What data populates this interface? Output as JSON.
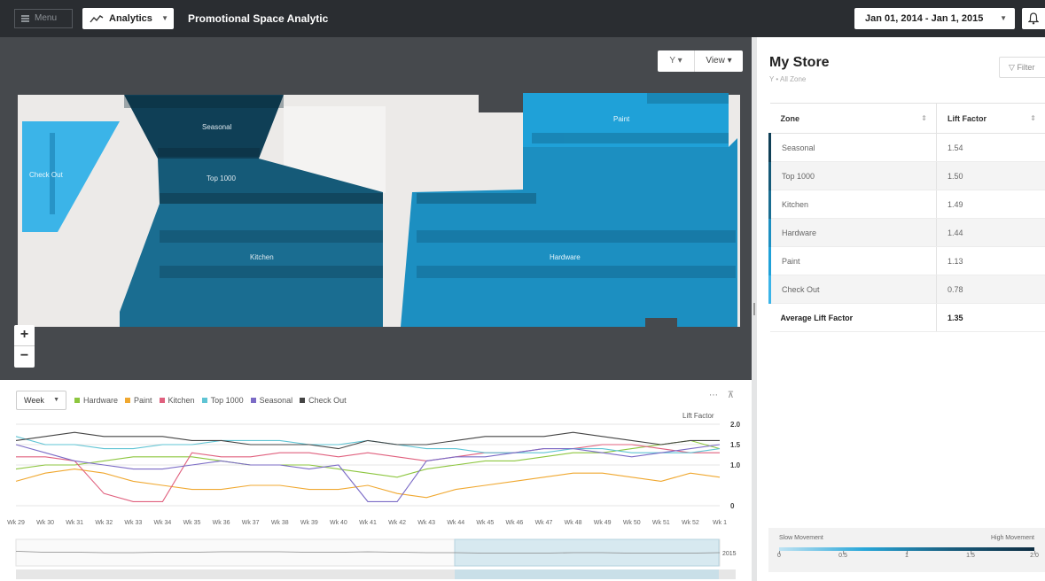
{
  "topbar": {
    "menu_label": "Menu",
    "analytics_label": "Analytics",
    "app_title": "Promotional Space Analytic",
    "date_range": "Jan 01, 2014 - Jan 1, 2015"
  },
  "map": {
    "filter_label": "Y",
    "view_label": "View",
    "zones": [
      {
        "name": "Seasonal",
        "color": "#0f3f56"
      },
      {
        "name": "Top 1000",
        "color": "#155a78"
      },
      {
        "name": "Kitchen",
        "color": "#1a6d91"
      },
      {
        "name": "Check Out",
        "color": "#3bb4e8"
      },
      {
        "name": "Paint",
        "color": "#1fa1d8"
      },
      {
        "name": "Hardware",
        "color": "#1c8fc1"
      }
    ],
    "zoom_in": "+",
    "zoom_out": "−"
  },
  "panel": {
    "title": "My Store",
    "subtitle": "Y • All Zone",
    "filter_label": "Filter",
    "columns": [
      "Zone",
      "Lift Factor"
    ],
    "rows": [
      {
        "zone": "Seasonal",
        "lift": "1.54",
        "color": "#0f3f56"
      },
      {
        "zone": "Top 1000",
        "lift": "1.50",
        "color": "#155a78"
      },
      {
        "zone": "Kitchen",
        "lift": "1.49",
        "color": "#1a6d91"
      },
      {
        "zone": "Hardware",
        "lift": "1.44",
        "color": "#1c8fc1"
      },
      {
        "zone": "Paint",
        "lift": "1.13",
        "color": "#1fa1d8"
      },
      {
        "zone": "Check Out",
        "lift": "0.78",
        "color": "#3bb4e8"
      }
    ],
    "average_label": "Average Lift Factor",
    "average_value": "1.35",
    "legend_low": "Slow Movement",
    "legend_high": "High Movement",
    "legend_ticks": [
      "0",
      "0.5",
      "1",
      "1.5",
      "2.0"
    ]
  },
  "chart_data": {
    "type": "line",
    "view_label": "Week",
    "ylabel": "Lift Factor",
    "ylim": [
      0,
      2.0
    ],
    "yticks": [
      "2.0",
      "1.5",
      "1.0",
      "0"
    ],
    "categories": [
      "Wk 29",
      "Wk 30",
      "Wk 31",
      "Wk 32",
      "Wk 33",
      "Wk 34",
      "Wk 35",
      "Wk 36",
      "Wk 37",
      "Wk 38",
      "Wk 39",
      "Wk 40",
      "Wk 41",
      "Wk 42",
      "Wk 43",
      "Wk 44",
      "Wk 45",
      "Wk 46",
      "Wk 47",
      "Wk 48",
      "Wk 49",
      "Wk 50",
      "Wk 51",
      "Wk 52",
      "Wk 1"
    ],
    "series": [
      {
        "name": "Hardware",
        "color": "#8dc63f",
        "values": [
          0.9,
          1.0,
          1.0,
          1.1,
          1.2,
          1.2,
          1.2,
          1.1,
          1.0,
          1.0,
          1.0,
          0.9,
          0.8,
          0.7,
          0.9,
          1.0,
          1.1,
          1.1,
          1.2,
          1.3,
          1.3,
          1.4,
          1.5,
          1.6,
          1.4
        ]
      },
      {
        "name": "Paint",
        "color": "#f0a830",
        "values": [
          0.6,
          0.8,
          0.9,
          0.8,
          0.6,
          0.5,
          0.4,
          0.4,
          0.5,
          0.5,
          0.4,
          0.4,
          0.5,
          0.3,
          0.2,
          0.4,
          0.5,
          0.6,
          0.7,
          0.8,
          0.8,
          0.7,
          0.6,
          0.8,
          0.7
        ]
      },
      {
        "name": "Kitchen",
        "color": "#e0607e",
        "values": [
          1.2,
          1.2,
          1.1,
          0.3,
          0.1,
          0.1,
          1.3,
          1.2,
          1.2,
          1.3,
          1.3,
          1.2,
          1.3,
          1.2,
          1.1,
          1.2,
          1.3,
          1.3,
          1.4,
          1.4,
          1.5,
          1.5,
          1.4,
          1.3,
          1.3
        ]
      },
      {
        "name": "Top 1000",
        "color": "#5fc4d4",
        "values": [
          1.7,
          1.5,
          1.5,
          1.4,
          1.4,
          1.5,
          1.5,
          1.6,
          1.6,
          1.6,
          1.5,
          1.5,
          1.6,
          1.5,
          1.4,
          1.4,
          1.3,
          1.3,
          1.3,
          1.4,
          1.4,
          1.3,
          1.3,
          1.3,
          1.4
        ]
      },
      {
        "name": "Seasonal",
        "color": "#7b6bc6",
        "values": [
          1.5,
          1.3,
          1.1,
          1.0,
          0.9,
          0.9,
          1.0,
          1.1,
          1.0,
          1.0,
          0.9,
          1.0,
          0.1,
          0.1,
          1.1,
          1.2,
          1.2,
          1.3,
          1.4,
          1.4,
          1.3,
          1.2,
          1.3,
          1.4,
          1.5
        ]
      },
      {
        "name": "Check Out",
        "color": "#444444",
        "values": [
          1.6,
          1.7,
          1.8,
          1.7,
          1.7,
          1.7,
          1.6,
          1.6,
          1.5,
          1.5,
          1.5,
          1.4,
          1.6,
          1.5,
          1.5,
          1.6,
          1.7,
          1.7,
          1.7,
          1.8,
          1.7,
          1.6,
          1.5,
          1.6,
          1.6
        ]
      }
    ],
    "navigator_year": "2015",
    "navigator_week": "01"
  }
}
